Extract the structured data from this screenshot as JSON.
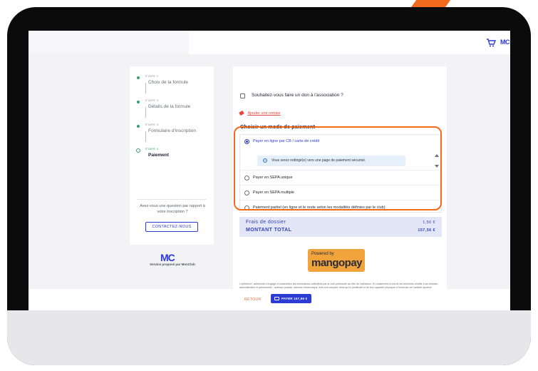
{
  "brand": {
    "mini_logo": "MC",
    "logo": "MC",
    "service_text": "Service proposé par MonClub"
  },
  "steps": [
    {
      "tag": "ÉTAPE 1",
      "name": "Choix de la formule"
    },
    {
      "tag": "ÉTAPE 2",
      "name": "Détails de la formule"
    },
    {
      "tag": "ÉTAPE 3",
      "name": "Formulaire d'inscription"
    },
    {
      "tag": "ÉTAPE 4",
      "name": "Paiement"
    }
  ],
  "help": {
    "question": "Avez-vous une question par rapport à votre inscription ?",
    "contact_label": "CONTACTEZ-NOUS"
  },
  "donation": {
    "label": "Souhaitez-vous faire un don à l'association ?"
  },
  "promo": {
    "label": "Ajouter une remise"
  },
  "payment": {
    "title": "Choisir un mode de paiement",
    "options": [
      {
        "label": "Payer en ligne par CB / carte de crédit",
        "selected": true
      },
      {
        "label": "Payer en SEPA unique",
        "selected": false
      },
      {
        "label": "Payer en SEPA multiple",
        "selected": false
      },
      {
        "label": "Paiement partiel (en ligne et le reste selon les modalités définies par le club)",
        "selected": false
      }
    ],
    "info": "Vous serez redirigé(e) vers une page de paiement sécurisé."
  },
  "totals": {
    "fees_label": "Frais de dossier",
    "fees_value": "1,56 €",
    "total_label": "MONTANT TOTAL",
    "total_value": "157,56 €"
  },
  "mangopay": {
    "powered": "Powered by",
    "name": "mangopay"
  },
  "legal": "L'adhérent / adhérente s'engage à transmettre les informations sollicitées par le club pertinente au titre de l'adhésion. Et notamment à fournir les éléments relatifs à sa situation administrative et personnelle : adresse postale, adresse électronique, état civil complet, ainsi qu'un justificatif et de leur capacité physique à l'exercice de l'activité sportive souhaitée. Il est précisé que pour toute déclaration mensongère ou erronée l'adhérent, l'adhérente encourt l'annulation de son inscription.",
  "footer": {
    "back_label": "RETOUR",
    "pay_label": "PAYER 157,56 €"
  },
  "colors": {
    "accent": "#2c3bd6",
    "highlight": "#f26a1e",
    "success": "#2fa36b",
    "mangopay": "#f1a43b"
  }
}
